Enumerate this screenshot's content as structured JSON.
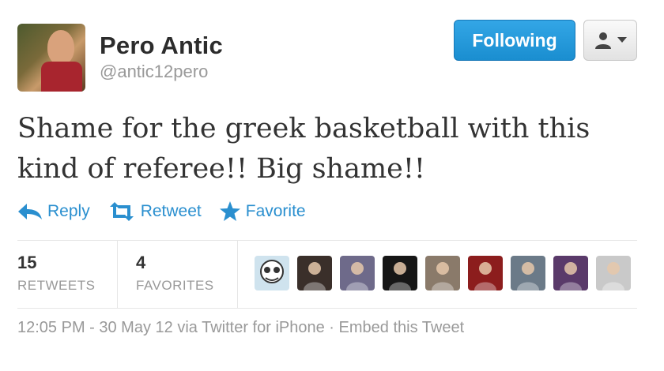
{
  "tweet": {
    "author_name": "Pero Antic",
    "author_handle": "@antic12pero",
    "text": "Shame for the greek basketball with this kind of referee!! Big shame!!",
    "follow_label": "Following"
  },
  "actions": {
    "reply": "Reply",
    "retweet": "Retweet",
    "favorite": "Favorite"
  },
  "stats": {
    "retweets_count": "15",
    "retweets_label": "RETWEETS",
    "favorites_count": "4",
    "favorites_label": "FAVORITES"
  },
  "favoriters": [
    {
      "icon": "avatar-cartoon",
      "color": "#cfe3ee"
    },
    {
      "icon": "avatar-photo",
      "color": "#3a2f2a"
    },
    {
      "icon": "avatar-photo",
      "color": "#6e6a8a"
    },
    {
      "icon": "avatar-photo",
      "color": "#161616"
    },
    {
      "icon": "avatar-photo",
      "color": "#8a7a6a"
    },
    {
      "icon": "avatar-photo",
      "color": "#8c1d1d"
    },
    {
      "icon": "avatar-photo",
      "color": "#6b7a88"
    },
    {
      "icon": "avatar-photo",
      "color": "#5a3a6a"
    },
    {
      "icon": "avatar-photo",
      "color": "#c9c9c9"
    }
  ],
  "footer": {
    "time": "12:05 PM - 30 May 12",
    "via": "via Twitter for iPhone",
    "separator": "·",
    "embed": "Embed this Tweet"
  },
  "colors": {
    "accent": "#2a8fcf",
    "follow_button": "#1a8ed0"
  }
}
